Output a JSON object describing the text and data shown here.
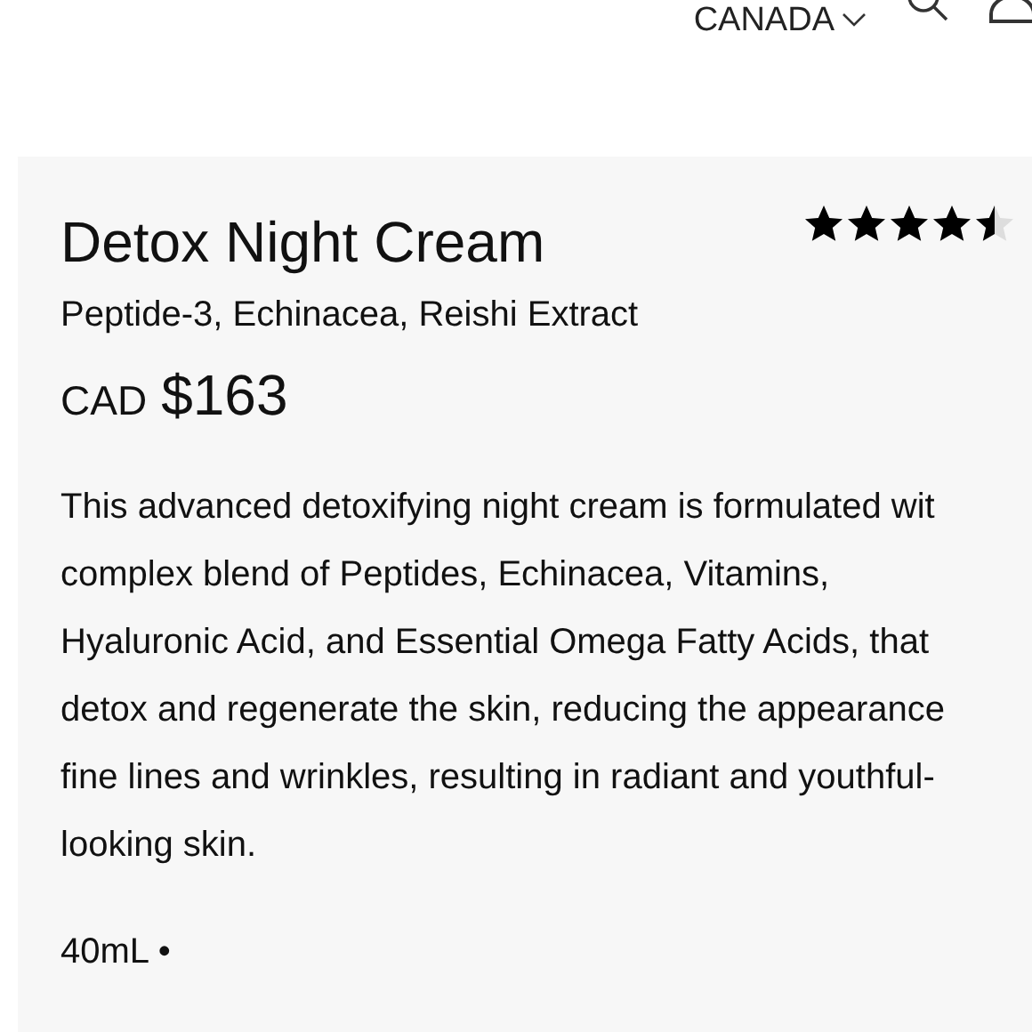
{
  "header": {
    "region": "CANADA"
  },
  "product": {
    "name": "Detox Night Cream",
    "stars": 4.5,
    "ingredients": "Peptide-3, Echinacea, Reishi Extract",
    "currency": "CAD",
    "price": "$163",
    "description_lines": [
      "This advanced detoxifying night cream is formulated wit",
      "complex blend of Peptides, Echinacea, Vitamins,",
      "Hyaluronic Acid, and Essential Omega Fatty Acids, that",
      "detox and regenerate the skin, reducing the appearance",
      "fine lines and wrinkles, resulting in radiant and youthful-",
      "looking skin."
    ],
    "size": "40mL •"
  }
}
